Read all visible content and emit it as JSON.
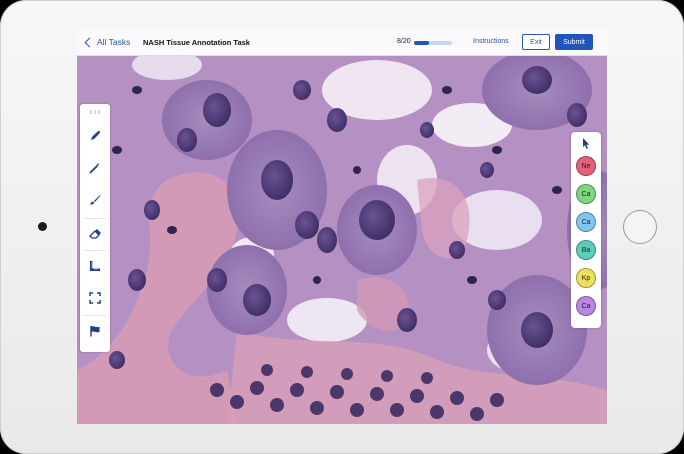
{
  "header": {
    "back_label": "All Tasks",
    "task_title": "NASH Tissue Annotation Task",
    "progress_text": "8/20",
    "progress_fraction": 0.4,
    "instructions_label": "Instructions",
    "exit_label": "Exit",
    "submit_label": "Submit"
  },
  "toolbar": {
    "tools": [
      {
        "name": "pen-tool",
        "icon": "pen-icon"
      },
      {
        "name": "magic-wand-tool",
        "icon": "magic-wand-icon"
      },
      {
        "name": "brush-tool",
        "icon": "brush-icon"
      },
      {
        "name": "eraser-tool",
        "icon": "eraser-icon"
      },
      {
        "name": "ruler-tool",
        "icon": "ruler-icon"
      },
      {
        "name": "fullscreen-tool",
        "icon": "expand-icon"
      },
      {
        "name": "flag-tool",
        "icon": "flag-icon"
      }
    ]
  },
  "palette": {
    "labels": [
      {
        "text": "Ne",
        "color": "#e5607a"
      },
      {
        "text": "Ca",
        "color": "#7fd67e"
      },
      {
        "text": "Ca",
        "color": "#7fc7ef"
      },
      {
        "text": "Ba",
        "color": "#5ccdbd"
      },
      {
        "text": "Kp",
        "color": "#efe05c"
      },
      {
        "text": "Ca",
        "color": "#b985e6"
      }
    ]
  },
  "colors": {
    "accent": "#1f56b9",
    "tissue_stroma": "#d79cb6",
    "tissue_nucleus": "#4c3a78",
    "tissue_cytoplasm": "#b48bc0"
  }
}
